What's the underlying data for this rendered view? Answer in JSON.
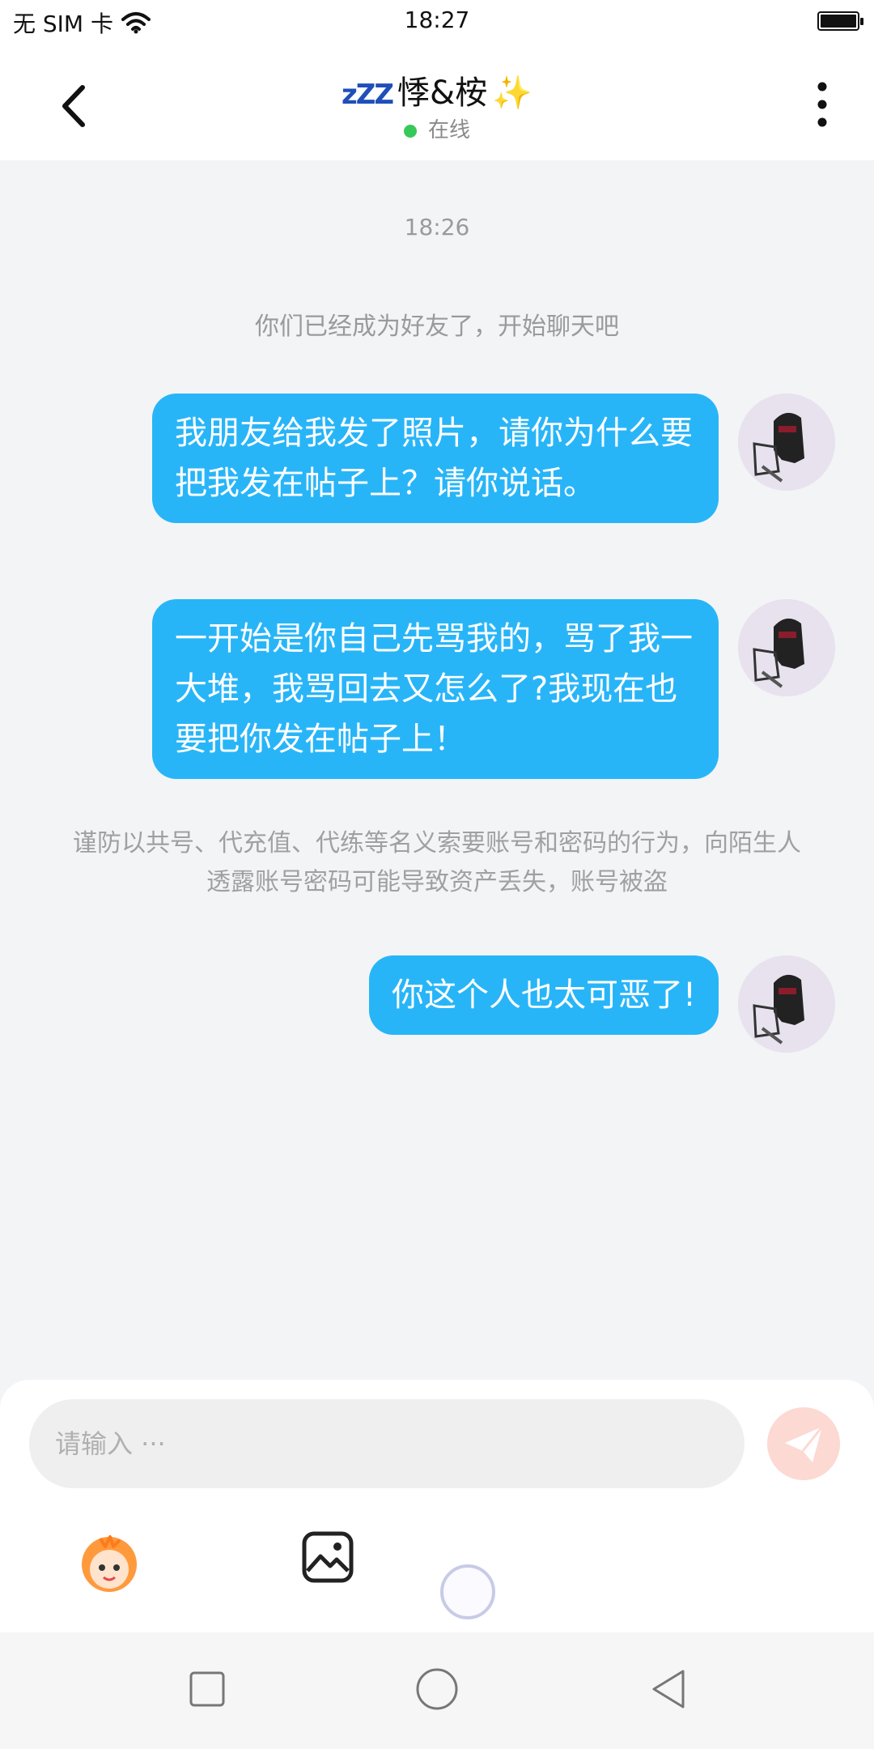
{
  "status_bar": {
    "carrier": "无 SIM 卡",
    "time": "18:27"
  },
  "header": {
    "zzz": "zZZ",
    "name": "悸&桉",
    "sparkle": "✨",
    "status": "在线"
  },
  "chat": {
    "timestamp": "18:26",
    "system_message": "你们已经成为好友了，开始聊天吧",
    "messages": [
      {
        "text": "我朋友给我发了照片，请你为什么要把我发在帖子上？请你说话。"
      },
      {
        "text": "一开始是你自己先骂我的，骂了我一大堆，我骂回去又怎么了?我现在也要把你发在帖子上！"
      },
      {
        "text": "你这个人也太可恶了!"
      }
    ],
    "notice": "谨防以共号、代充值、代练等名义索要账号和密码的行为，向陌生人透露账号密码可能导致资产丢失，账号被盗"
  },
  "input": {
    "placeholder": "请输入 ···"
  },
  "colors": {
    "bubble": "#28b5f8",
    "online_dot": "#36c95a",
    "send_button": "#fcd9d2"
  },
  "icons": {
    "back": "chevron-left-icon",
    "more": "more-vertical-icon",
    "send": "paper-plane-icon",
    "sticker": "sticker-icon",
    "image": "image-icon",
    "nav_recent": "square-icon",
    "nav_home": "circle-icon",
    "nav_back": "triangle-back-icon"
  }
}
